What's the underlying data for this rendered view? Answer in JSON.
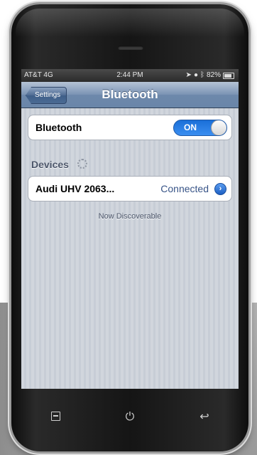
{
  "status_bar": {
    "carrier": "AT&T  4G",
    "time": "2:44 PM",
    "battery": "82%",
    "battery_level": 0.82,
    "icons": [
      "signal-icon",
      "location-icon",
      "lock-rotation-icon",
      "bluetooth-icon",
      "battery-icon"
    ]
  },
  "nav": {
    "back_label": "Settings",
    "title": "Bluetooth"
  },
  "bluetooth_row": {
    "label": "Bluetooth",
    "toggle_label": "ON",
    "toggle_state": true
  },
  "devices": {
    "header": "Devices",
    "items": [
      {
        "name": "Audi UHV 2063...",
        "status": "Connected"
      }
    ]
  },
  "discoverable_text": "Now Discoverable",
  "softkeys": [
    "menu-icon",
    "power-icon",
    "back-icon"
  ],
  "colors": {
    "accent": "#2a7ee6",
    "nav_bar": "#6d88ab",
    "background": "#c7cdd6"
  }
}
